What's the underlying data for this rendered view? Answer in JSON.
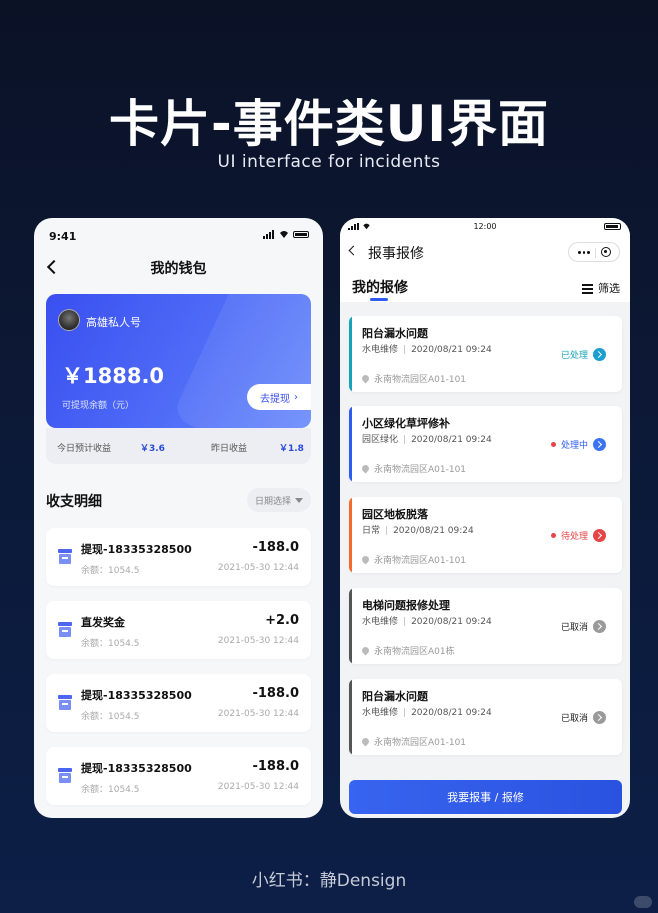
{
  "hero": {
    "title": "卡片-事件类UI界面",
    "subtitle": "UI interface for incidents"
  },
  "wallet": {
    "time": "9:41",
    "nav_title": "我的钱包",
    "account_name": "高雄私人号",
    "balance": "￥1888.0",
    "balance_label": "可提现余额（元）",
    "withdraw_label": "去提现",
    "today_label": "今日预计收益",
    "today_value": "￥3.6",
    "yesterday_label": "昨日收益",
    "yesterday_value": "￥1.8",
    "section_title": "收支明细",
    "date_picker": "日期选择",
    "transactions": [
      {
        "title": "提现-18335328500",
        "amount": "-188.0",
        "balance": "余额：1054.5",
        "date": "2021-05-30 12:44"
      },
      {
        "title": "直发奖金",
        "amount": "+2.0",
        "balance": "余额：1054.5",
        "date": "2021-05-30 12:44"
      },
      {
        "title": "提现-18335328500",
        "amount": "-188.0",
        "balance": "余额：1054.5",
        "date": "2021-05-30 12:44"
      },
      {
        "title": "提现-18335328500",
        "amount": "-188.0",
        "balance": "余额：1054.5",
        "date": "2021-05-30 12:44"
      }
    ]
  },
  "repair": {
    "time": "12:00",
    "nav_title": "报事报修",
    "tab_label": "我的报修",
    "filter_label": "筛选",
    "button_label": "我要报事 / 报修",
    "tickets": [
      {
        "title": "阳台漏水问题",
        "category": "水电维修",
        "date": "2020/08/21 09:24",
        "location": "永南物流园区A01-101",
        "status": "已处理",
        "bar_color": "#16a3b8",
        "status_color": "#16a3b8",
        "arrow_color": "#1a9fd0",
        "dot": false
      },
      {
        "title": "小区绿化草坪修补",
        "category": "园区绿化",
        "date": "2020/08/21 09:24",
        "location": "永南物流园区A01-101",
        "status": "处理中",
        "bar_color": "#2c5df0",
        "status_color": "#2c5df0",
        "arrow_color": "#3b74f2",
        "dot": true,
        "dot_color": "#e64545"
      },
      {
        "title": "园区地板脱落",
        "category": "日常",
        "date": "2020/08/21 09:24",
        "location": "永南物流园区A01-101",
        "status": "待处理",
        "bar_color": "#f26b2a",
        "status_color": "#e64545",
        "arrow_color": "#e64545",
        "dot": true,
        "dot_color": "#e64545"
      },
      {
        "title": "电梯问题报修处理",
        "category": "水电维修",
        "date": "2020/08/21 09:24",
        "location": "永南物流园区A01栋",
        "status": "已取消",
        "bar_color": "#555555",
        "status_color": "#222222",
        "arrow_color": "#9a9a9a",
        "dot": false
      },
      {
        "title": "阳台漏水问题",
        "category": "水电维修",
        "date": "2020/08/21 09:24",
        "location": "永南物流园区A01-101",
        "status": "已取消",
        "bar_color": "#555555",
        "status_color": "#222222",
        "arrow_color": "#9a9a9a",
        "dot": false
      }
    ]
  },
  "footer": {
    "credit": "小红书：静Densign"
  }
}
